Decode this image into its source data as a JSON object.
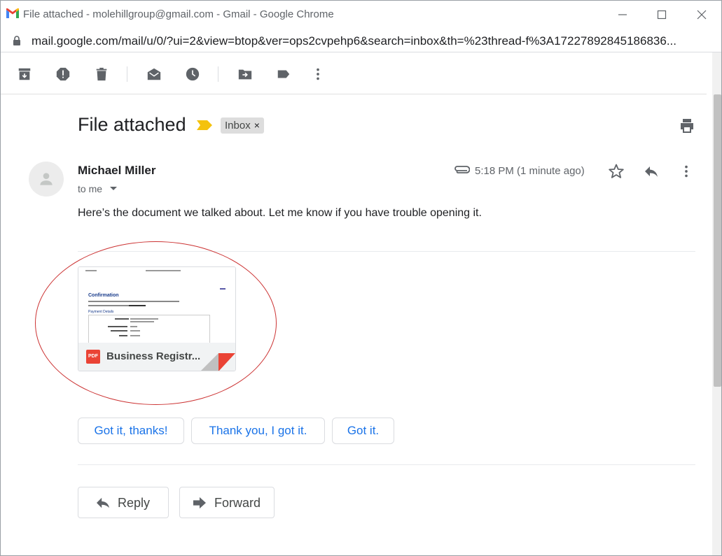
{
  "window": {
    "title": "File attached - molehillgroup@gmail.com - Gmail - Google Chrome",
    "url": "mail.google.com/mail/u/0/?ui=2&view=btop&ver=ops2cvpehp6&search=inbox&th=%23thread-f%3A17227892845186836..."
  },
  "toolbar": {
    "icons": [
      "archive-icon",
      "report-spam-icon",
      "delete-icon",
      "mark-unread-icon",
      "snooze-icon",
      "move-to-icon",
      "label-icon",
      "more-vert-icon"
    ]
  },
  "email": {
    "subject": "File attached",
    "label": "Inbox",
    "label_remove": "×",
    "sender": "Michael Miller",
    "recipient": "to me",
    "time": "5:18 PM (1 minute ago)",
    "body": "Here’s the document we talked about. Let me know if you have trouble opening it."
  },
  "attachment": {
    "type_badge": "PDF",
    "filename": "Business Registr...",
    "preview_heading": "Confirmation",
    "preview_subheading": "Payment Details"
  },
  "smart_replies": [
    "Got it, thanks!",
    "Thank you, I got it.",
    "Got it."
  ],
  "actions": {
    "reply": "Reply",
    "forward": "Forward"
  },
  "colors": {
    "accent_blue": "#1a73e8",
    "importance_yellow": "#f4c20d",
    "annotation_red": "#cc3333",
    "pdf_red": "#ea4335"
  }
}
